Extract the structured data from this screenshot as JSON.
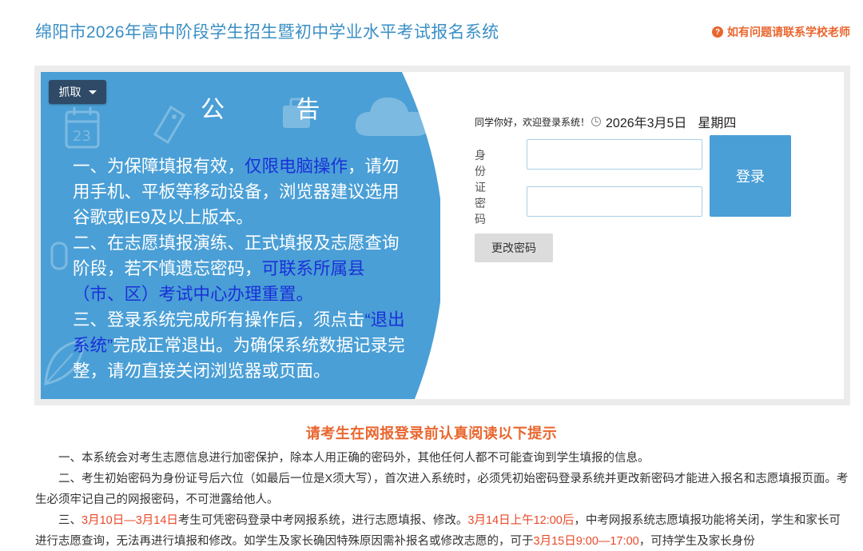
{
  "header": {
    "title": "绵阳市2026年高中阶段学生招生暨初中学业水平考试报名系统",
    "help_text": "如有问题请联系学校老师",
    "help_icon": "question-circle-icon"
  },
  "notice": {
    "grab_label": "抓取",
    "title": "公 告",
    "p1_a": "一、为保障填报有效，",
    "p1_hl": "仅限电脑操作",
    "p1_b": "，请勿用手机、平板等移动设备，浏览器建议选用谷歌或IE9及以上版本。",
    "p2_a": "二、在志愿填报演练、正式填报及志愿查询阶段，若不慎遗忘密码，",
    "p2_hl": "可联系所属县（市、区）考试中心办理重置。",
    "p3_a": "三、登录系统完成所有操作后，须点击",
    "p3_hl": "“退出系统”",
    "p3_b": "完成正常退出。为确保系统数据记录完整，请勿直接关闭浏览器或页面。",
    "colors": {
      "background": "#4a9fd6",
      "highlight": "#1a30d8"
    }
  },
  "login": {
    "greeting": "同学你好，欢迎登录系统！",
    "date": "2026年3月5日",
    "weekday": "星期四",
    "id_label": "身份证",
    "password_label": "密码",
    "id_value": "",
    "password_value": "",
    "login_label": "登录",
    "change_password_label": "更改密码"
  },
  "tips": {
    "title": "请考生在网报登录前认真阅读以下提示",
    "t1": "一、本系统会对考生志愿信息进行加密保护，除本人用正确的密码外，其他任何人都不可能查询到学生填报的信息。",
    "t2": "二、考生初始密码为身份证号后六位（如最后一位是X须大写），首次进入系统时，必须凭初始密码登录系统并更改新密码才能进入报名和志愿填报页面。考生必须牢记自己的网报密码，不可泄露给他人。",
    "t3_a": "三、",
    "t3_r1": "3月10日—3月14日",
    "t3_b": "考生可凭密码登录中考网报系统，进行志愿填报、修改。",
    "t3_r2": "3月14日上午12:00后",
    "t3_c": "，中考网报系统志愿填报功能将关闭，学生和家长可进行志愿查询，无法再进行填报和修改。如学生及家长确因特殊原因需补报名或修改志愿的，可于",
    "t3_r3": "3月15日9:00—17:00",
    "t3_d": "，可持学生及家长身份",
    "colors": {
      "title": "#e9662f",
      "highlight": "#e94a2a"
    }
  }
}
